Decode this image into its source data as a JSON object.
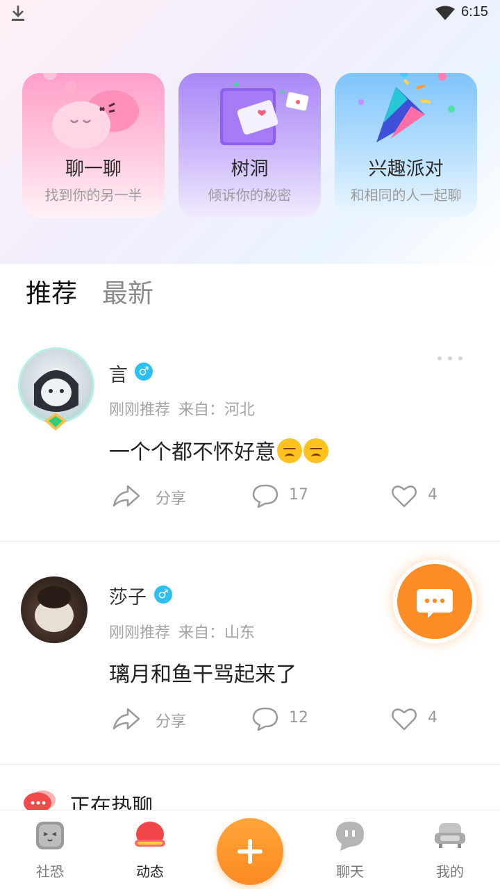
{
  "status_bar": {
    "time": "6:15"
  },
  "feature_cards": [
    {
      "title": "聊一聊",
      "subtitle": "找到你的另一半"
    },
    {
      "title": "树洞",
      "subtitle": "倾诉你的秘密"
    },
    {
      "title": "兴趣派对",
      "subtitle": "和相同的人一起聊"
    }
  ],
  "tabs": {
    "active": "推荐",
    "other": "最新"
  },
  "posts": [
    {
      "name": "言",
      "gender": "♂",
      "time": "刚刚推荐",
      "location": "来自：河北",
      "content": "一个个都不怀好意",
      "share_label": "分享",
      "comments": "17",
      "likes": "4"
    },
    {
      "name": "莎子",
      "gender": "♂",
      "time": "刚刚推荐",
      "location": "来自：山东",
      "content": "璃月和鱼干骂起来了",
      "share_label": "分享",
      "comments": "12",
      "likes": "4"
    }
  ],
  "hot_chat": {
    "title": "正在热聊"
  },
  "bottom_nav": [
    {
      "label": "社恐"
    },
    {
      "label": "动态"
    },
    {
      "label": "聊天"
    },
    {
      "label": "我的"
    }
  ],
  "colors": {
    "accent": "#fb8c26",
    "gender_male": "#2cc0f2"
  },
  "icons": [
    "download-icon",
    "wifi-icon",
    "share-icon",
    "comment-icon",
    "heart-icon",
    "more-icon",
    "message-icon",
    "plus-icon"
  ]
}
